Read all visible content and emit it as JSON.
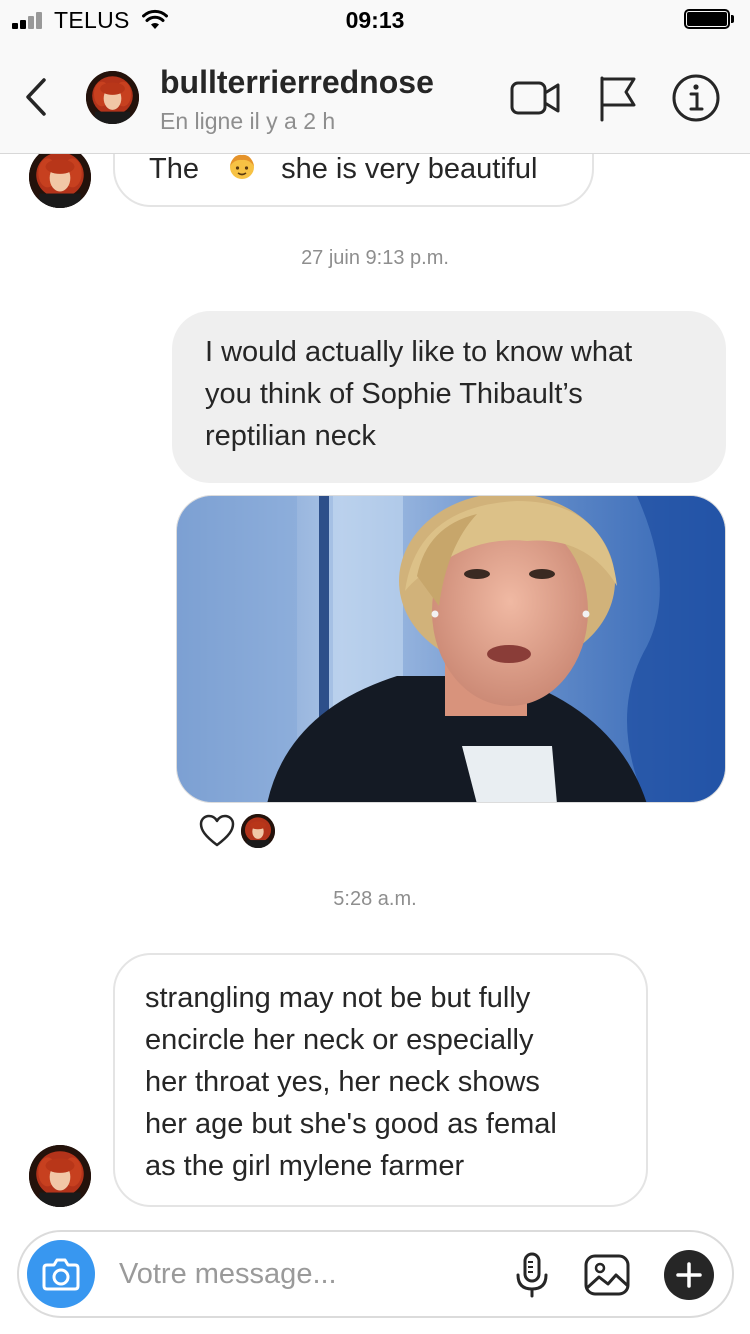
{
  "status_bar": {
    "carrier": "TELUS",
    "time": "09:13"
  },
  "header": {
    "username": "bullterrierrednose",
    "presence": "En ligne il y a 2 h",
    "icons": [
      "chevron-left-icon",
      "video-camera-icon",
      "flag-icon",
      "info-icon"
    ]
  },
  "messages": {
    "first_partial": {
      "word_before": "The",
      "emoji": "girl-emoji",
      "word_after": "she is very beautiful"
    },
    "timestamp_1": "27 juin 9:13 p.m.",
    "outgoing_text": [
      "I would actually like to know what",
      "you think of Sophie Thibault’s",
      "reptilian neck"
    ],
    "photo": {
      "kind": "shared-photo"
    },
    "timestamp_2": "5:28 a.m.",
    "incoming_text": [
      "strangling may not be but fully",
      "encircle her neck or especially",
      "her throat yes, her neck shows",
      "her age but she's good as femal",
      "as the girl mylene farmer"
    ]
  },
  "composer": {
    "placeholder": "Votre message...",
    "icons": [
      "camera-icon",
      "microphone-icon",
      "gallery-icon",
      "plus-icon"
    ]
  },
  "colors": {
    "accent": "#3897f0",
    "bubble_out": "#efefef",
    "bubble_in_border": "#e4e4e4",
    "muted_text": "#8e8e8e"
  }
}
